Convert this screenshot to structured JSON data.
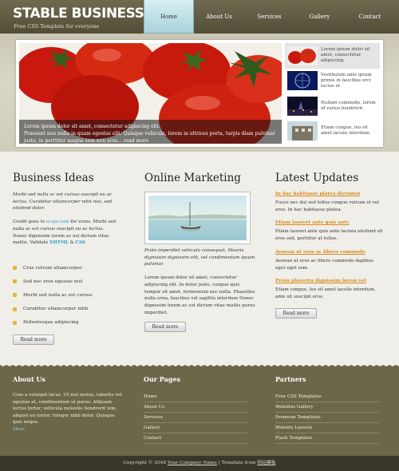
{
  "header": {
    "logo": "STABLE BUSINESS",
    "tagline": "Free CSS Template for everyone",
    "nav": [
      "Home",
      "About Us",
      "Services",
      "Gallery",
      "Contact"
    ]
  },
  "slider": {
    "caption_title": "Lorem ipsum dolor sit amet, consectetur adipiscing elit.",
    "caption_text": "Praesent non nulla in quam egestas elit. Quisque vehicula, lorem in ultrices porta, turpis diam pulvinar justo, in porttitor magna sem non eros...",
    "caption_more": "read more",
    "thumbs": [
      "Lorem ipsum dolor sit amet, consectetur adipiscing",
      "Vestibulum ante ipsum primis in faucibus orci luctus et",
      "Nullam commodo, lorem id varius hendrerit.",
      "Etiam congue, leo sit amet iaculis interdum"
    ]
  },
  "business": {
    "title": "Business Ideas",
    "intro": "Morbi sed nulla ac est cursus suscipit eu ac lectus. Curabitur ullamcorper nibh nisi, sed eleifend dolor.",
    "credit_prefix": "Credit goes to",
    "credit_link": "ocojo.com",
    "credit_mid": "for icons. Morbi sed nulla ac est cursus suscipit eu ac lectus. Donec dignissim lorem ac est dictum vitae mattis. Validate",
    "xhtml": "XHTML",
    "amp": "&",
    "css": "CSS",
    "bullets": [
      "Cras rutrum ullamcorper",
      "Sed nec eros egestas nisl",
      "Morbi sed nulla ac est cursus",
      "Curabitur ullamcorper nibh",
      "Pellentesque adipiscing"
    ],
    "read_more": "Read more"
  },
  "marketing": {
    "title": "Online Marketing",
    "intro": "Proin imperdiet vehicula consequat. Mauris dignissim dignissim elit, vel condimentum ipsum pulvinar.",
    "body": "Lorem ipsum dolor sit amet, consectetur adipiscing elit. In dolor justo, congue quis tempor sit amet, fermentum nec nulla. Phasellus nulla urna, faucibus vel sagittis interdum Donec dignissim lorem ac est dictum vitae mattis purus imperdiet.",
    "read_more": "Read more"
  },
  "updates": {
    "title": "Latest Updates",
    "items": [
      {
        "title": "In hac habitasse platea dictumst",
        "text": "Fusce nec dui sed tellus congue rutrum et vel eros. In hac habitasse platea."
      },
      {
        "title": "Etiam laoreet ante quis ante",
        "text": "Etiam laoreet ante quis ante lacinia eleifend sit eros sed, porttitor at tellus."
      },
      {
        "title": "Aenean ut eros ac libero commodo",
        "text": "Aenean ut eros ac libero commodo dapibus eget eget sem."
      },
      {
        "title": "Proin pharetra dignissim lorem vel",
        "text": "Etiam congue, leo sit amet iaculis interdum, ante sit suscipit eros."
      }
    ],
    "read_more": "Read more"
  },
  "footer": {
    "about_title": "About Us",
    "about_text": "Cras a volutpat lacus. Ut nisi metus, lobortis vel egestas et, condimentum ut purus. Aliquam lectus tortor, vehicula molestie hendrerit non, aliquet eu tortor. Integer nibh dolor. Quisque quis neque.",
    "about_more": "More",
    "pages_title": "Our Pages",
    "pages": [
      "Home",
      "About Us",
      "Services",
      "Gallery",
      "Contact"
    ],
    "partners_title": "Partners",
    "partners": [
      "Free CSS Templates",
      "Websites Gallery",
      "Premium Templates",
      "Website Layouts",
      "Flash Templates"
    ],
    "copyright_prefix": "Copyright © 2048",
    "company": "Your Company Name",
    "template_from": "| Template from",
    "source": "网站模板"
  },
  "colors": {
    "header": "#5f5a41",
    "accent": "#2a9cc5",
    "update_link": "#d98a1a",
    "footer": "#6c6748"
  }
}
